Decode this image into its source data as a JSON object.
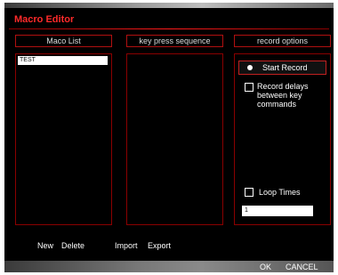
{
  "window": {
    "title": "Macro Editor"
  },
  "columns": {
    "macro_list": "Maco List",
    "key_sequence": "key press sequence",
    "record_options": "record options"
  },
  "macros": [
    "TEST"
  ],
  "record_options": {
    "start_record_label": "Start Record",
    "record_delays_label": "Record delays\nbetween key\ncommands",
    "record_delays_checked": false,
    "loop_times_label": "Loop Times",
    "loop_times_checked": false,
    "loop_times_value": "1"
  },
  "actions": {
    "new": "New",
    "delete": "Delete",
    "import": "Import",
    "export": "Export"
  },
  "footer": {
    "ok": "OK",
    "cancel": "CANCEL"
  }
}
